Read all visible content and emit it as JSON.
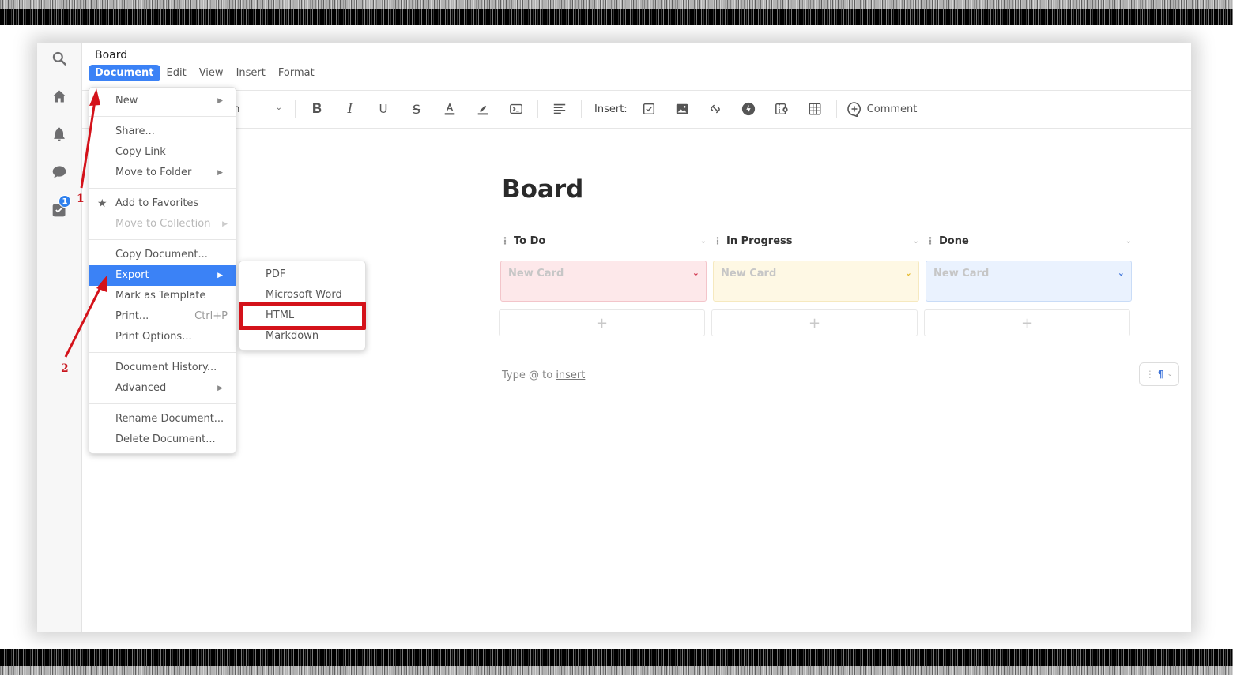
{
  "app": {
    "doc_title": "Board",
    "menubar": [
      "Document",
      "Edit",
      "View",
      "Insert",
      "Format"
    ],
    "active_menu": "Document"
  },
  "sidebar": {
    "icons": [
      "search-icon",
      "home-icon",
      "bell-icon",
      "chat-icon",
      "tasks-icon"
    ],
    "tasks_badge": "1"
  },
  "toolbar": {
    "paragraph_style": "Paragraph",
    "paragraph_style_visible": "ph",
    "insert_label": "Insert:",
    "comment_label": "Comment",
    "format_buttons": [
      "bold",
      "italic",
      "underline",
      "strikethrough",
      "text-color",
      "highlight",
      "code"
    ],
    "insert_buttons": [
      "checkbox",
      "image",
      "link",
      "live-app",
      "embed",
      "table"
    ]
  },
  "document_menu": {
    "items": [
      {
        "label": "New",
        "submenu": true
      },
      {
        "sep": true
      },
      {
        "label": "Share..."
      },
      {
        "label": "Copy Link"
      },
      {
        "label": "Move to Folder",
        "submenu": true
      },
      {
        "sep": true
      },
      {
        "label": "Add to Favorites",
        "icon": "star-icon"
      },
      {
        "label": "Move to Collection",
        "submenu": true,
        "disabled": true
      },
      {
        "sep": true
      },
      {
        "label": "Copy Document..."
      },
      {
        "label": "Export",
        "submenu": true,
        "highlighted": true
      },
      {
        "label": "Mark as Template"
      },
      {
        "label": "Print...",
        "shortcut": "Ctrl+P"
      },
      {
        "label": "Print Options..."
      },
      {
        "sep": true
      },
      {
        "label": "Document History..."
      },
      {
        "label": "Advanced",
        "submenu": true
      },
      {
        "sep": true
      },
      {
        "label": "Rename Document..."
      },
      {
        "label": "Delete Document..."
      }
    ]
  },
  "export_submenu": {
    "items": [
      "PDF",
      "Microsoft Word",
      "HTML",
      "Markdown"
    ],
    "highlighted": "HTML"
  },
  "page": {
    "heading": "Board",
    "columns": [
      {
        "title": "To Do",
        "card": "New Card",
        "color_bg": "#fde8ea",
        "color_border": "#f3c5ca",
        "accent": "#d0314a"
      },
      {
        "title": "In Progress",
        "card": "New Card",
        "color_bg": "#fef8e4",
        "color_border": "#f6e9bf",
        "accent": "#e5b92a"
      },
      {
        "title": "Done",
        "card": "New Card",
        "color_bg": "#eaf2fe",
        "color_border": "#c9dcf7",
        "accent": "#3b72d9"
      }
    ],
    "add_label": "+",
    "hint_prefix": "Type @ to ",
    "hint_link": "insert",
    "paragraph_mark": "¶"
  },
  "annotations": {
    "step1": "1",
    "step2": "2",
    "color": "#d4121a"
  }
}
